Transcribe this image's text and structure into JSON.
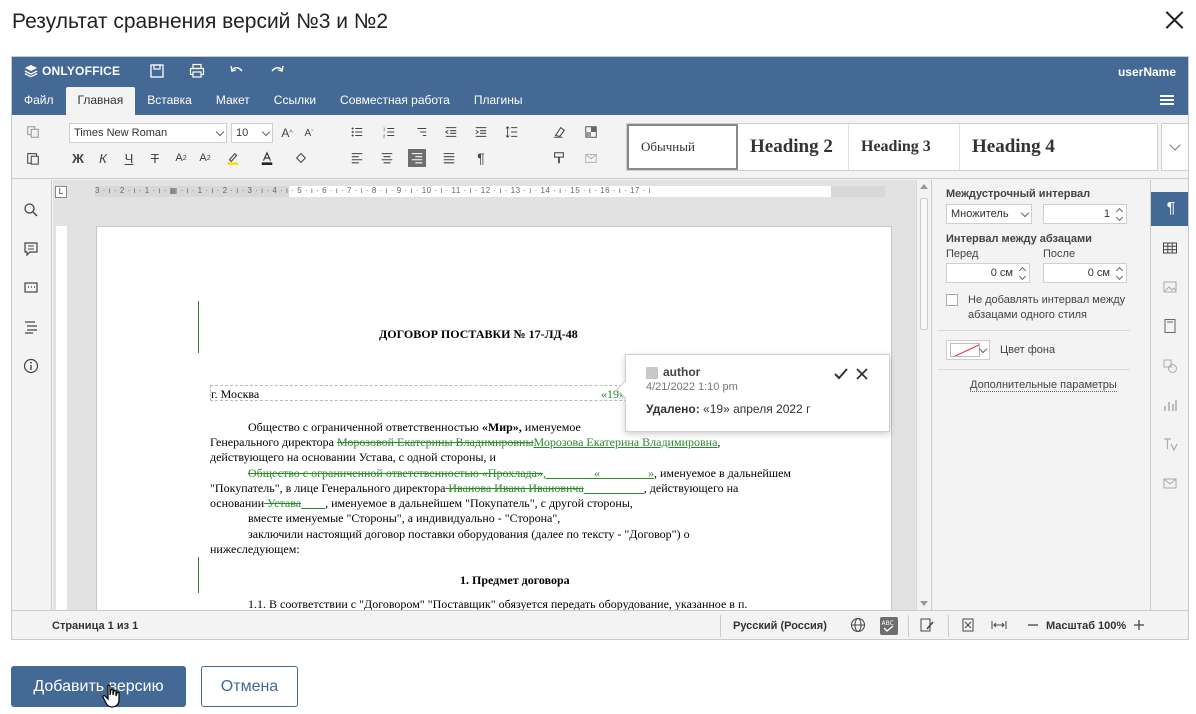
{
  "dialog": {
    "title": "Результат сравнения версий №3 и №2",
    "add_version_button": "Добавить версию",
    "cancel_button": "Отмена"
  },
  "editor": {
    "logo": "ONLYOFFICE",
    "username": "userName",
    "tabs": [
      "Файл",
      "Главная",
      "Вставка",
      "Макет",
      "Ссылки",
      "Совместная работа",
      "Плагины"
    ],
    "active_tab": "Главная",
    "font_name": "Times New Roman",
    "font_size": "10",
    "styles": [
      "Обычный",
      "Heading 2",
      "Heading 3",
      "Heading 4"
    ]
  },
  "document": {
    "title": "ДОГОВОР ПОСТАВКИ № 17-ЛД-48",
    "city": "г. Москва",
    "date_deleted": "«19»",
    "p1_a": "Общество с ограниченной ответственностью ",
    "p1_bold": "«Мир»,",
    "p1_b": " именуемое",
    "p2_a": "Генерального директора ",
    "p2_del": "Морозовой Екатерины Владимировны",
    "p2_ins": "Морозова Екатерина Владимировна",
    "p2_b": ",",
    "p3": "действующего на основании Устава, с одной стороны, и",
    "p4_del": "Общество с ограниченной ответственностью «Прохлада»",
    "p4_ins": ",________«________»",
    "p4_b": ", именуемое в дальнейшем",
    "p5_a": "\"Покупатель\", в лице Генерального директора",
    "p5_del": " Иванова Ивана Ивановича",
    "p5_ins": "__________",
    "p5_b": ", действующего на",
    "p6_a": "основании",
    "p6_del": " Устава",
    "p6_ins": "____",
    "p6_b": ", именуемое в дальнейшем \"Покупатель\", с другой стороны,",
    "p7": "вместе именуемые \"Стороны\", а индивидуально - \"Сторона\",",
    "p8": "заключили настоящий договор поставки оборудования (далее по тексту - \"Договор\") о",
    "p9": "нижеследующем:",
    "section1": "1. Предмет договора",
    "p10": "1.1. В соответствии с \"Договором\" \"Поставщик\" обязуется передать оборудование, указанное в п."
  },
  "tooltip": {
    "author": "author",
    "date": "4/21/2022 1:10 pm",
    "label": "Удалено:",
    "value": " «19» апреля 2022 г"
  },
  "right_panel": {
    "line_spacing_label": "Междустрочный интервал",
    "line_spacing_mode": "Множитель",
    "line_spacing_value": "1",
    "para_spacing_label": "Интервал между абзацами",
    "before_label": "Перед",
    "after_label": "После",
    "before_value": "0 см",
    "after_value": "0 см",
    "no_spacing_checkbox": "Не добавлять интервал между абзацами одного стиля",
    "bg_color_label": "Цвет фона",
    "advanced_link": "Дополнительные параметры"
  },
  "statusbar": {
    "page_info": "Страница 1 из 1",
    "language": "Русский (Россия)",
    "zoom": "Масштаб 100%"
  },
  "colors": {
    "accent": "#446995",
    "track_change": "#2a8a2a"
  }
}
